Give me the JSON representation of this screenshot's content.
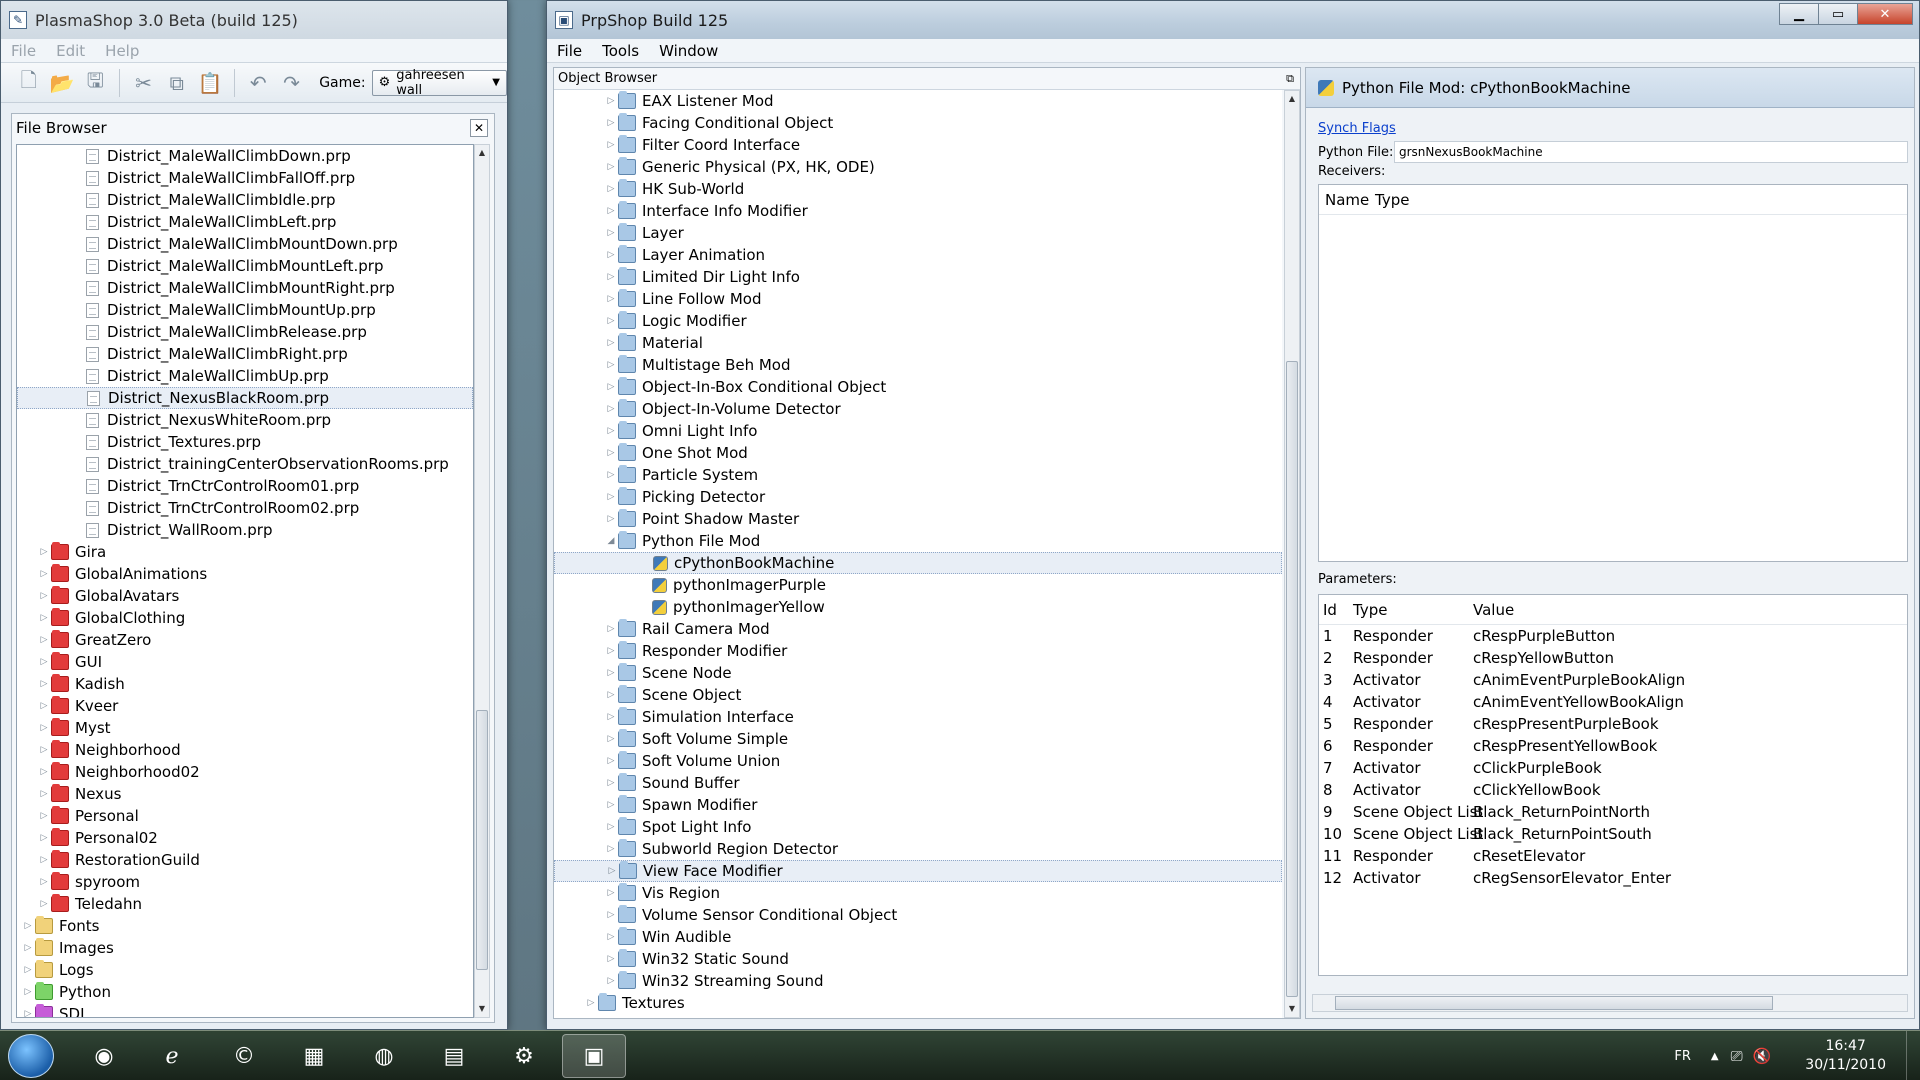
{
  "plasmashop": {
    "title": "PlasmaShop 3.0 Beta (build 125)",
    "menu": [
      "File",
      "Edit",
      "Help"
    ],
    "game_label": "Game:",
    "game_value": "gahreesen wall",
    "file_browser_title": "File Browser",
    "files": [
      "District_MaleWallClimbDown.prp",
      "District_MaleWallClimbFallOff.prp",
      "District_MaleWallClimbIdle.prp",
      "District_MaleWallClimbLeft.prp",
      "District_MaleWallClimbMountDown.prp",
      "District_MaleWallClimbMountLeft.prp",
      "District_MaleWallClimbMountRight.prp",
      "District_MaleWallClimbMountUp.prp",
      "District_MaleWallClimbRelease.prp",
      "District_MaleWallClimbRight.prp",
      "District_MaleWallClimbUp.prp",
      "District_NexusBlackRoom.prp",
      "District_NexusWhiteRoom.prp",
      "District_Textures.prp",
      "District_trainingCenterObservationRooms.prp",
      "District_TrnCtrControlRoom01.prp",
      "District_TrnCtrControlRoom02.prp",
      "District_WallRoom.prp"
    ],
    "age_folders": [
      "Gira",
      "GlobalAnimations",
      "GlobalAvatars",
      "GlobalClothing",
      "GreatZero",
      "GUI",
      "Kadish",
      "Kveer",
      "Myst",
      "Neighborhood",
      "Neighborhood02",
      "Nexus",
      "Personal",
      "Personal02",
      "RestorationGuild",
      "spyroom",
      "Teledahn"
    ],
    "top_folders": [
      {
        "name": "Fonts",
        "color": "yellow"
      },
      {
        "name": "Images",
        "color": "yellow"
      },
      {
        "name": "Logs",
        "color": "yellow"
      },
      {
        "name": "Python",
        "color": "green"
      },
      {
        "name": "SDL",
        "color": "purple"
      }
    ]
  },
  "prpshop": {
    "title": "PrpShop Build 125",
    "menu": [
      "File",
      "Tools",
      "Window"
    ],
    "object_browser_title": "Object Browser",
    "objects_before": [
      "EAX Listener Mod",
      "Facing Conditional Object",
      "Filter Coord Interface",
      "Generic Physical (PX, HK, ODE)",
      "HK Sub-World",
      "Interface Info Modifier",
      "Layer",
      "Layer Animation",
      "Limited Dir Light Info",
      "Line Follow Mod",
      "Logic Modifier",
      "Material",
      "Multistage Beh Mod",
      "Object-In-Box Conditional Object",
      "Object-In-Volume Detector",
      "Omni Light Info",
      "One Shot Mod",
      "Particle System",
      "Picking Detector",
      "Point Shadow Master"
    ],
    "expanded_object": "Python File Mod",
    "python_children": [
      "cPythonBookMachine",
      "pythonImagerPurple",
      "pythonImagerYellow"
    ],
    "objects_after": [
      "Rail Camera Mod",
      "Responder Modifier",
      "Scene Node",
      "Scene Object",
      "Simulation Interface",
      "Soft Volume Simple",
      "Soft Volume Union",
      "Sound Buffer",
      "Spawn Modifier",
      "Spot Light Info",
      "Subworld Region Detector",
      "View Face Modifier",
      "Vis Region",
      "Volume Sensor Conditional Object",
      "Win Audible",
      "Win32 Static Sound",
      "Win32 Streaming Sound"
    ],
    "root_item": "Textures",
    "properties": {
      "header": "Python File Mod: cPythonBookMachine",
      "synch_flags": "Synch Flags",
      "python_file_label": "Python File:",
      "python_file_value": "grsnNexusBookMachine",
      "receivers_label": "Receivers:",
      "receivers_cols": [
        "Name",
        "Type"
      ],
      "parameters_label": "Parameters:",
      "param_cols": [
        "Id",
        "Type",
        "Value"
      ],
      "params": [
        {
          "id": "1",
          "type": "Responder",
          "value": "cRespPurpleButton"
        },
        {
          "id": "2",
          "type": "Responder",
          "value": "cRespYellowButton"
        },
        {
          "id": "3",
          "type": "Activator",
          "value": "cAnimEventPurpleBookAlign"
        },
        {
          "id": "4",
          "type": "Activator",
          "value": "cAnimEventYellowBookAlign"
        },
        {
          "id": "5",
          "type": "Responder",
          "value": "cRespPresentPurpleBook"
        },
        {
          "id": "6",
          "type": "Responder",
          "value": "cRespPresentYellowBook"
        },
        {
          "id": "7",
          "type": "Activator",
          "value": "cClickPurpleBook"
        },
        {
          "id": "8",
          "type": "Activator",
          "value": "cClickYellowBook"
        },
        {
          "id": "9",
          "type": "Scene Object List",
          "value": "Black_ReturnPointNorth"
        },
        {
          "id": "10",
          "type": "Scene Object List",
          "value": "Black_ReturnPointSouth"
        },
        {
          "id": "11",
          "type": "Responder",
          "value": "cResetElevator"
        },
        {
          "id": "12",
          "type": "Activator",
          "value": "cRegSensorElevator_Enter"
        }
      ]
    }
  },
  "taskbar": {
    "language": "FR",
    "time": "16:47",
    "date": "30/11/2010"
  }
}
